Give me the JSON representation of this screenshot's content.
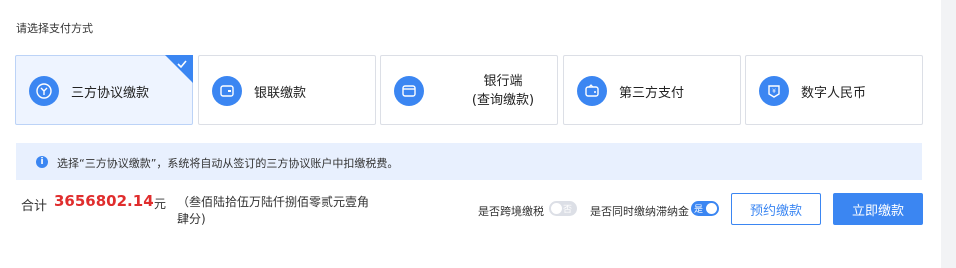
{
  "section_title": "请选择支付方式",
  "methods": [
    {
      "label": "三方协议缴款",
      "icon": "agreement-icon",
      "selected": true
    },
    {
      "label": "银联缴款",
      "icon": "card-icon",
      "selected": false
    },
    {
      "label_line1": "银行端",
      "label_line2": "(查询缴款)",
      "icon": "bank-wallet-icon",
      "selected": false
    },
    {
      "label": "第三方支付",
      "icon": "wallet-icon",
      "selected": false
    },
    {
      "label": "数字人民币",
      "icon": "digital-rmb-icon",
      "selected": false
    }
  ],
  "notice": {
    "text": "选择“三方协议缴款”，系统将自动从签订的三方协议账户中扣缴税费。",
    "icon": "info-icon"
  },
  "total": {
    "label": "合计",
    "amount": "3656802.14",
    "unit": "元",
    "in_words": "（叁佰陆拾伍万陆仟捌佰零贰元壹角肆分)"
  },
  "options": {
    "cross_border": {
      "label": "是否跨境缴税",
      "state_text": "否",
      "on": false
    },
    "late_fee": {
      "label": "是否同时缴纳滞纳金",
      "state_text": "是",
      "on": true
    }
  },
  "actions": {
    "reserve_label": "预约缴款",
    "pay_now_label": "立即缴款"
  },
  "colors": {
    "accent": "#3b86f2",
    "amount": "#e02d2d",
    "selected_bg": "#eef4ff",
    "notice_bg": "#e8f0fe"
  }
}
